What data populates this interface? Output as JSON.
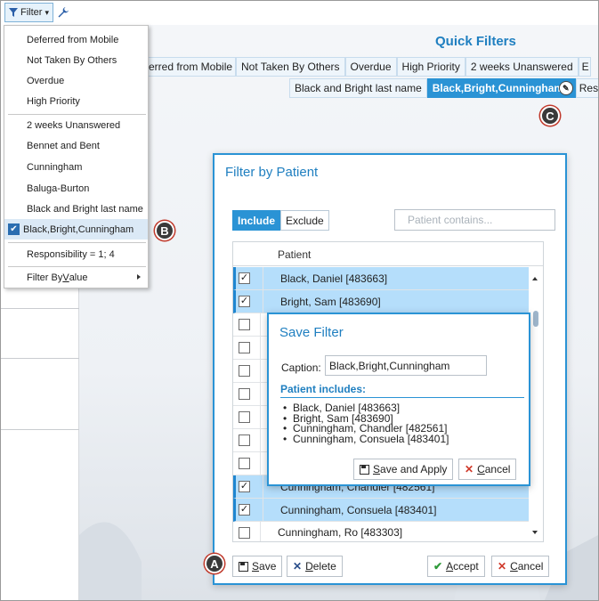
{
  "toolbar": {
    "filter_label": "Filter",
    "filter_caret": "▾",
    "settings_icon": "wrench-icon"
  },
  "filter_menu": {
    "items": [
      {
        "label": "Deferred from Mobile",
        "checked": false
      },
      {
        "label": "Not Taken By Others",
        "checked": false
      },
      {
        "label": "Overdue",
        "checked": false
      },
      {
        "label": "High Priority",
        "checked": false
      },
      {
        "label": "2 weeks Unanswered",
        "checked": false
      },
      {
        "label": "Bennet and Bent",
        "checked": false
      },
      {
        "label": "Cunningham",
        "checked": false
      },
      {
        "label": "Baluga-Burton",
        "checked": false
      },
      {
        "label": "Black and Bright last name",
        "checked": false
      },
      {
        "label": "Black,Bright,Cunningham",
        "checked": true
      },
      {
        "label": "Responsibility = 1; 4",
        "checked": false
      }
    ],
    "filter_by_value": {
      "before": "Filter By ",
      "underlined": "V",
      "after": "alue"
    }
  },
  "quick_filters": {
    "title": "Quick Filters",
    "row1": [
      "erred from Mobile",
      "Not Taken By Others",
      "Overdue",
      "High Priority",
      "2 weeks Unanswered",
      "E"
    ],
    "row2": [
      {
        "label": "Black and Bright last name",
        "active": false
      },
      {
        "label": "Black,Bright,Cunninghan",
        "active": true
      },
      {
        "label": "Respo",
        "active": false
      }
    ]
  },
  "callouts": {
    "a": "A",
    "b": "B",
    "c": "C"
  },
  "patient_dialog": {
    "title": "Filter by Patient",
    "include_label": "Include",
    "exclude_label": "Exclude",
    "search_placeholder": "Patient contains...",
    "column_header": "Patient",
    "rows": [
      {
        "name": "Black, Daniel [483663]",
        "checked": true
      },
      {
        "name": "Bright, Sam [483690]",
        "checked": true
      },
      {
        "name": "",
        "checked": false
      },
      {
        "name": "",
        "checked": false
      },
      {
        "name": "",
        "checked": false
      },
      {
        "name": "",
        "checked": false
      },
      {
        "name": "",
        "checked": false
      },
      {
        "name": "",
        "checked": false
      },
      {
        "name": "",
        "checked": false
      },
      {
        "name": "Cunningham, Chandler [482561]",
        "checked": true
      },
      {
        "name": "Cunningham, Consuela [483401]",
        "checked": true
      },
      {
        "name": "Cunningham, Ro [483303]",
        "checked": false
      }
    ],
    "save_btn": {
      "underlined": "S",
      "rest": "ave"
    },
    "delete_btn": {
      "underlined": "D",
      "rest": "elete"
    },
    "accept_btn": {
      "underlined": "A",
      "rest": "ccept"
    },
    "cancel_btn": {
      "underlined": "C",
      "rest": "ancel"
    }
  },
  "save_filter": {
    "title": "Save Filter",
    "caption_label": "Caption:",
    "caption_value": "Black,Bright,Cunningham",
    "includes_title": "Patient includes:",
    "includes": [
      "Black, Daniel [483663]",
      "Bright, Sam [483690]",
      "Cunningham, Chandler [482561]",
      "Cunningham, Consuela [483401]"
    ],
    "save_apply_btn": {
      "underlined": "S",
      "rest": "ave and Apply"
    },
    "cancel_btn": {
      "underlined": "C",
      "rest": "ancel"
    }
  },
  "colors": {
    "accent": "#2a93d5",
    "title_blue": "#1f7fc0",
    "row_selected": "#b5defb",
    "cancel_red": "#d03a2b",
    "accept_green": "#2f9a3a"
  }
}
